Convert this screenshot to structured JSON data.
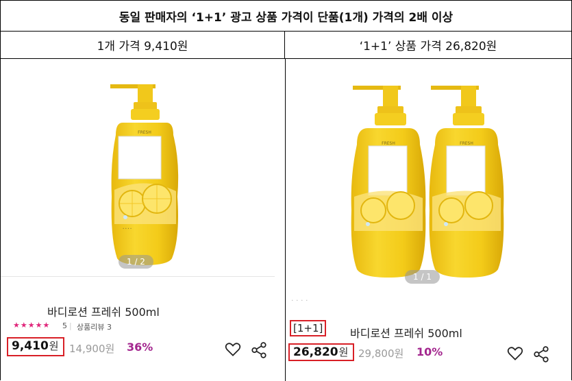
{
  "title": "동일 판매자의 ‘1+1’ 광고 상품 가격이 단품(1개) 가격의 2배 이상",
  "headers": {
    "left": "1개 가격 9,410원",
    "right": "‘1+1’ 상품 가격 26,820원"
  },
  "left_panel": {
    "pager": "1 / 2",
    "product_name": "바디로션 프레쉬 500ml",
    "stars": "★★★★★",
    "rating_count": "5",
    "review_label": "상품리뷰 3",
    "price": "9,410",
    "won": "원",
    "original_price": "14,900원",
    "discount": "36%",
    "bottle_label": "FRESH"
  },
  "right_panel": {
    "pager": "1 / 1",
    "badge": "[1+1]",
    "product_name": "바디로션 프레쉬 500ml",
    "price": "26,820",
    "won": "원",
    "original_price": "29,800원",
    "discount": "10%",
    "bottle_label": "FRESH"
  },
  "colors": {
    "highlight_red": "#d81f26",
    "discount_purple": "#a3268e",
    "bottle_yellow": "#f2cc1b",
    "star_pink": "#e0257a"
  }
}
